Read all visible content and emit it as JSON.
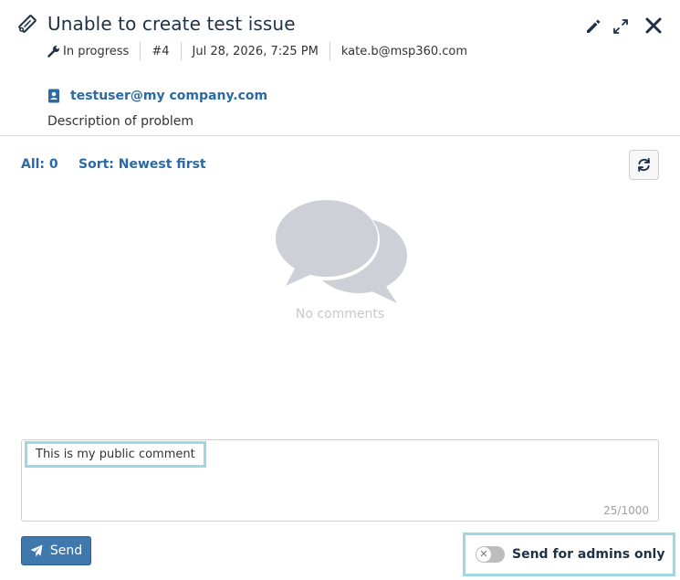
{
  "header": {
    "title": "Unable to create test issue",
    "status": "In progress",
    "number": "#4",
    "date": "Jul 28, 2026, 7:25 PM",
    "email": "kate.b@msp360.com"
  },
  "requester": {
    "email": "testuser@my company.com"
  },
  "description": "Description of problem",
  "filters": {
    "all_label": "All: 0",
    "sort_label": "Sort: Newest first"
  },
  "empty_state": {
    "text": "No comments"
  },
  "comment": {
    "value": "This is my public comment",
    "counter": "25/1000"
  },
  "actions": {
    "send_label": "Send",
    "admins_toggle_label": "Send for admins only",
    "admins_toggle_on": false
  },
  "icons": {
    "ticket": "ticket-icon",
    "edit": "pencil-icon",
    "expand": "expand-icon",
    "close": "close-icon",
    "status": "wrench-icon",
    "contact": "contact-book-icon",
    "refresh": "refresh-icon",
    "empty": "speech-bubbles-icon",
    "send": "paper-plane-icon"
  },
  "colors": {
    "title": "#1f3147",
    "link": "#2c6aa6",
    "button": "#3f78ad",
    "highlight": "#9fd6e5"
  }
}
